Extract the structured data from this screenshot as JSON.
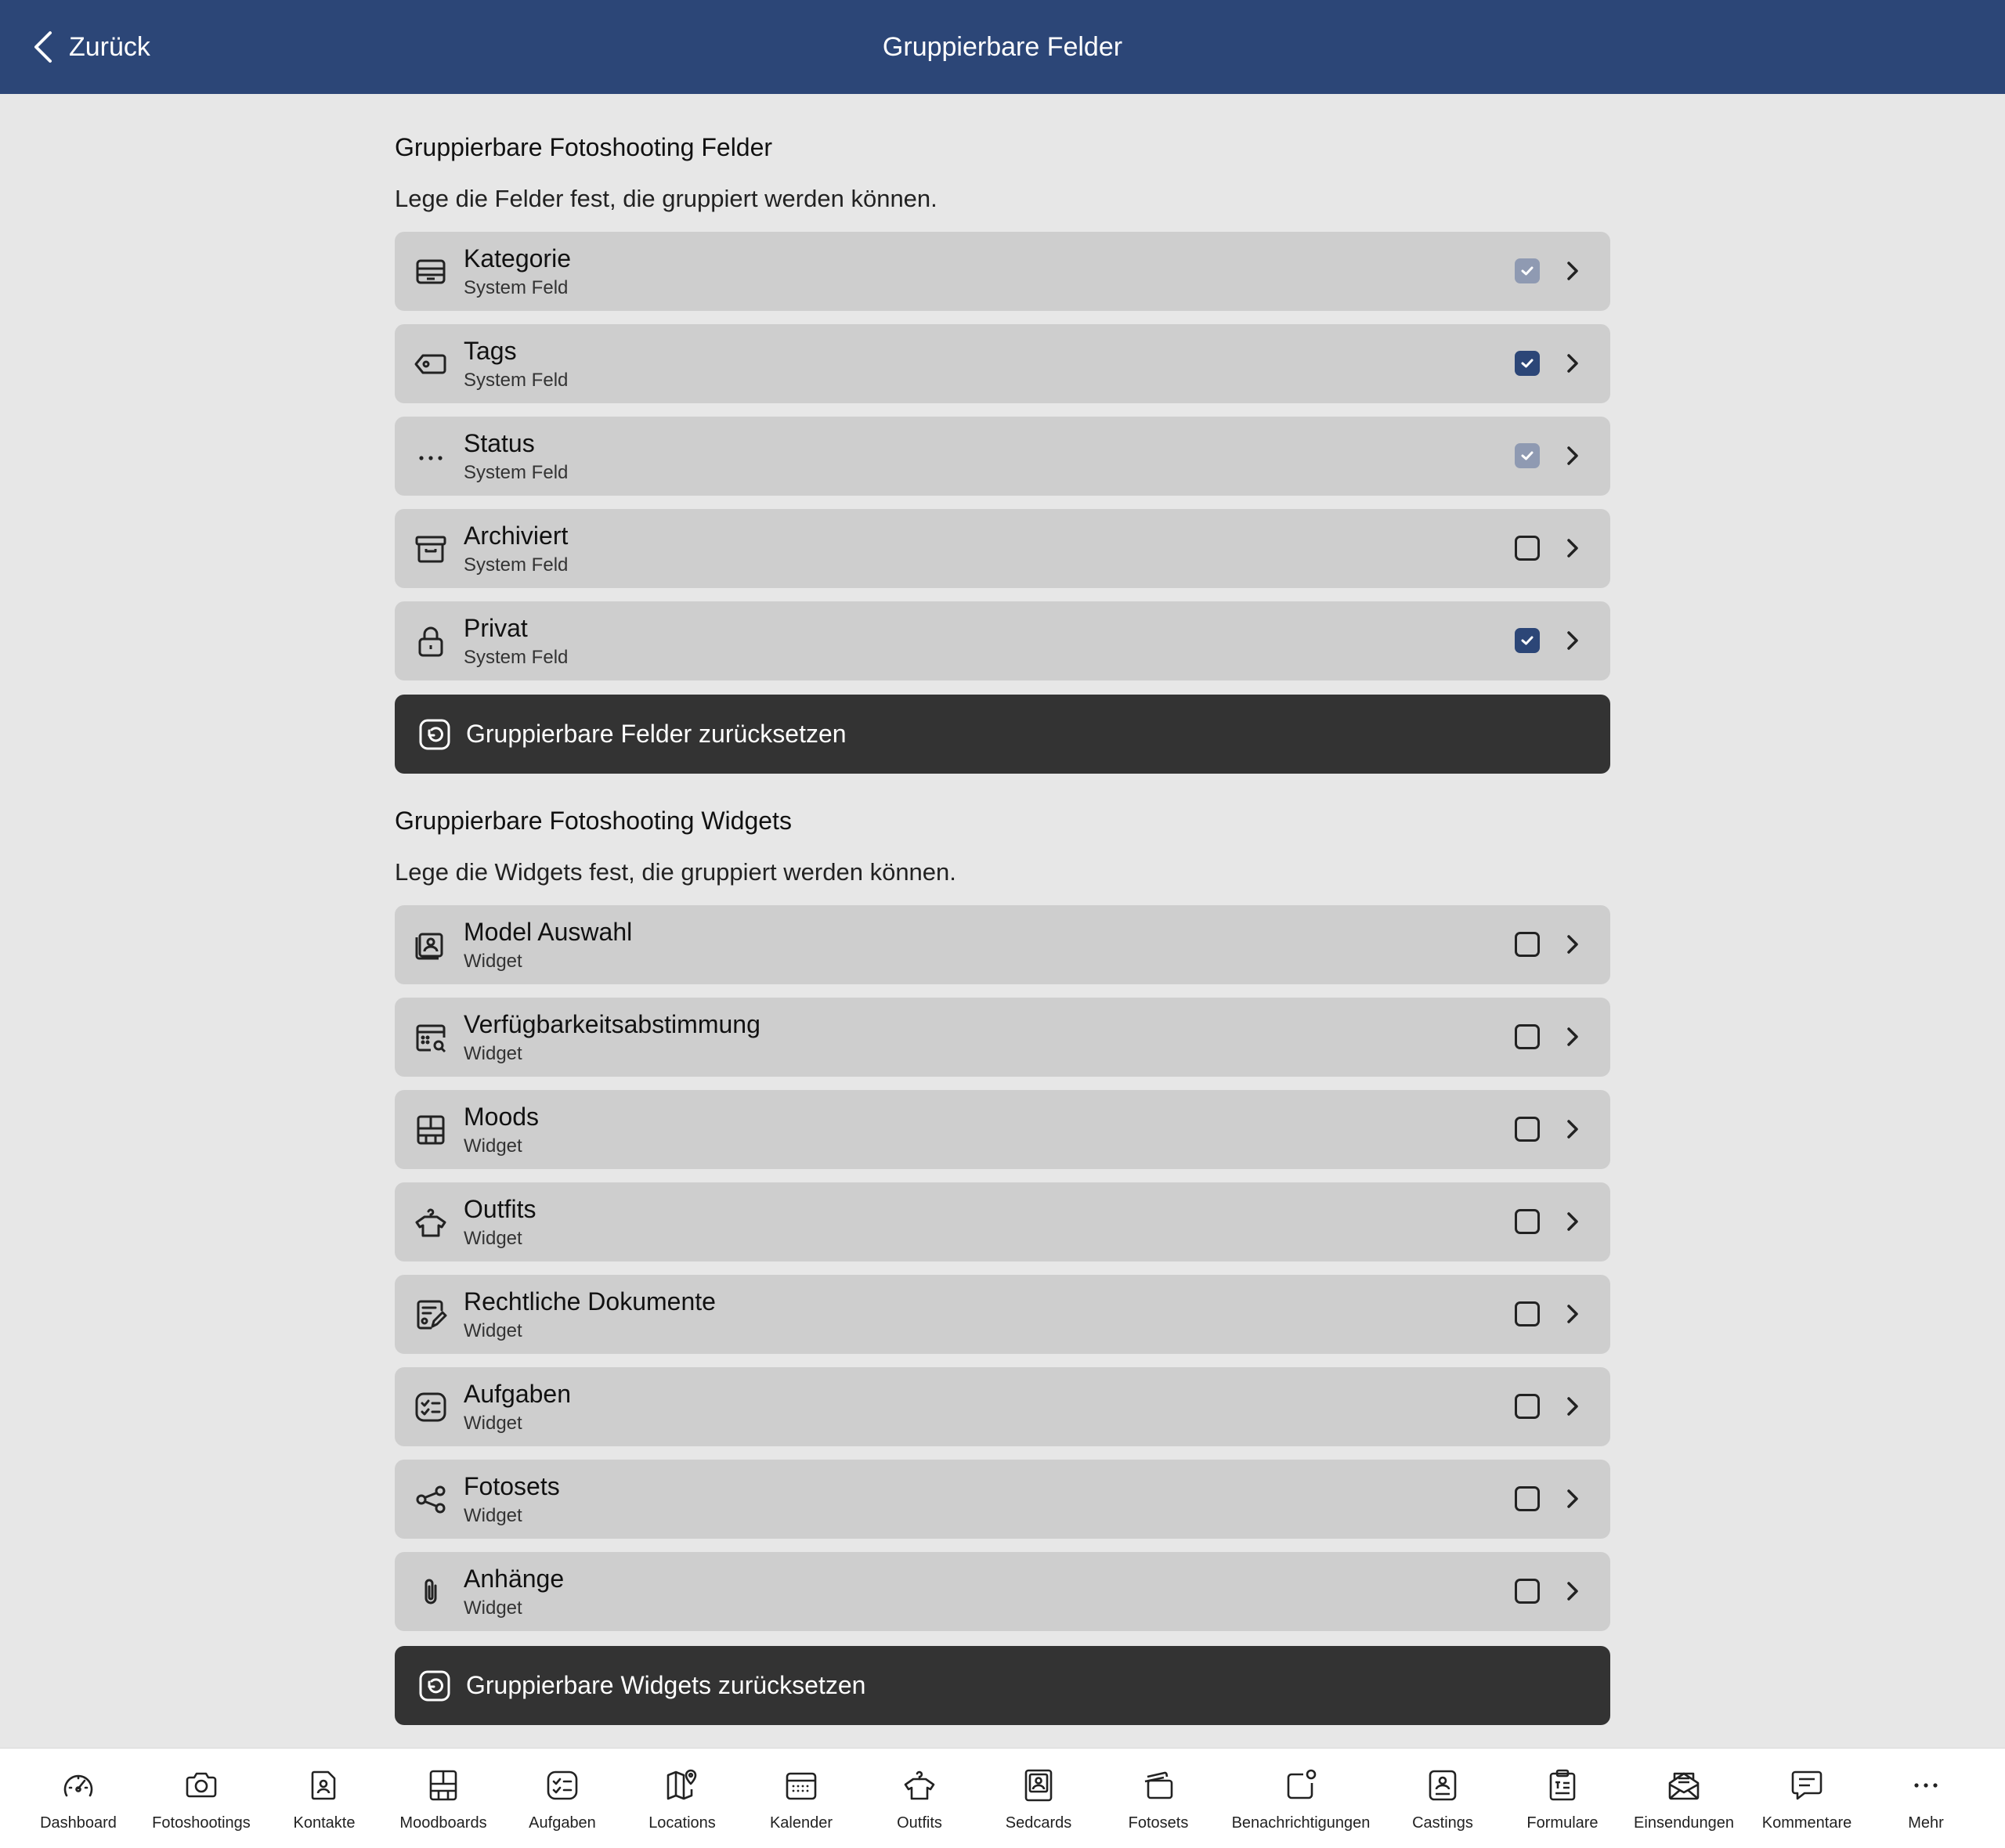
{
  "header": {
    "back_label": "Zurück",
    "title": "Gruppierbare Felder"
  },
  "fields_section": {
    "title": "Gruppierbare Fotoshooting Felder",
    "description": "Lege die Felder fest, die gruppiert werden können.",
    "items": [
      {
        "label": "Kategorie",
        "sub": "System Feld",
        "icon": "tray-icon",
        "checkbox": "checked-disabled"
      },
      {
        "label": "Tags",
        "sub": "System Feld",
        "icon": "tag-icon",
        "checkbox": "checked"
      },
      {
        "label": "Status",
        "sub": "System Feld",
        "icon": "ellipsis-icon",
        "checkbox": "checked-disabled"
      },
      {
        "label": "Archiviert",
        "sub": "System Feld",
        "icon": "archive-box-icon",
        "checkbox": "unchecked"
      },
      {
        "label": "Privat",
        "sub": "System Feld",
        "icon": "lock-icon",
        "checkbox": "checked"
      }
    ],
    "reset_label": "Gruppierbare Felder zurücksetzen"
  },
  "widgets_section": {
    "title": "Gruppierbare Fotoshooting Widgets",
    "description": "Lege die Widgets fest, die gruppiert werden können.",
    "items": [
      {
        "label": "Model Auswahl",
        "sub": "Widget",
        "icon": "portrait-stack-icon",
        "checkbox": "unchecked"
      },
      {
        "label": "Verfügbarkeitsabstimmung",
        "sub": "Widget",
        "icon": "calendar-search-icon",
        "checkbox": "unchecked"
      },
      {
        "label": "Moods",
        "sub": "Widget",
        "icon": "moodboard-grid-icon",
        "checkbox": "unchecked"
      },
      {
        "label": "Outfits",
        "sub": "Widget",
        "icon": "shirt-hanger-icon",
        "checkbox": "unchecked"
      },
      {
        "label": "Rechtliche Dokumente",
        "sub": "Widget",
        "icon": "document-pen-icon",
        "checkbox": "unchecked"
      },
      {
        "label": "Aufgaben",
        "sub": "Widget",
        "icon": "checklist-icon",
        "checkbox": "unchecked"
      },
      {
        "label": "Fotosets",
        "sub": "Widget",
        "icon": "share-nodes-icon",
        "checkbox": "unchecked"
      },
      {
        "label": "Anhänge",
        "sub": "Widget",
        "icon": "paperclip-icon",
        "checkbox": "unchecked"
      }
    ],
    "reset_label": "Gruppierbare Widgets zurücksetzen"
  },
  "tabbar": [
    {
      "label": "Dashboard",
      "icon": "gauge-icon"
    },
    {
      "label": "Fotoshootings",
      "icon": "camera-icon"
    },
    {
      "label": "Kontakte",
      "icon": "contact-card-icon"
    },
    {
      "label": "Moodboards",
      "icon": "moodboard-grid-icon"
    },
    {
      "label": "Aufgaben",
      "icon": "checklist-icon"
    },
    {
      "label": "Locations",
      "icon": "map-pin-icon"
    },
    {
      "label": "Kalender",
      "icon": "calendar-icon"
    },
    {
      "label": "Outfits",
      "icon": "shirt-hanger-icon"
    },
    {
      "label": "Sedcards",
      "icon": "portrait-card-icon"
    },
    {
      "label": "Fotosets",
      "icon": "photo-stack-icon"
    },
    {
      "label": "Benachrichtigungen",
      "icon": "notification-badge-icon"
    },
    {
      "label": "Castings",
      "icon": "casting-card-icon"
    },
    {
      "label": "Formulare",
      "icon": "clipboard-form-icon"
    },
    {
      "label": "Einsendungen",
      "icon": "envelope-open-icon"
    },
    {
      "label": "Kommentare",
      "icon": "comment-icon"
    },
    {
      "label": "Mehr",
      "icon": "more-ellipsis-icon"
    }
  ]
}
